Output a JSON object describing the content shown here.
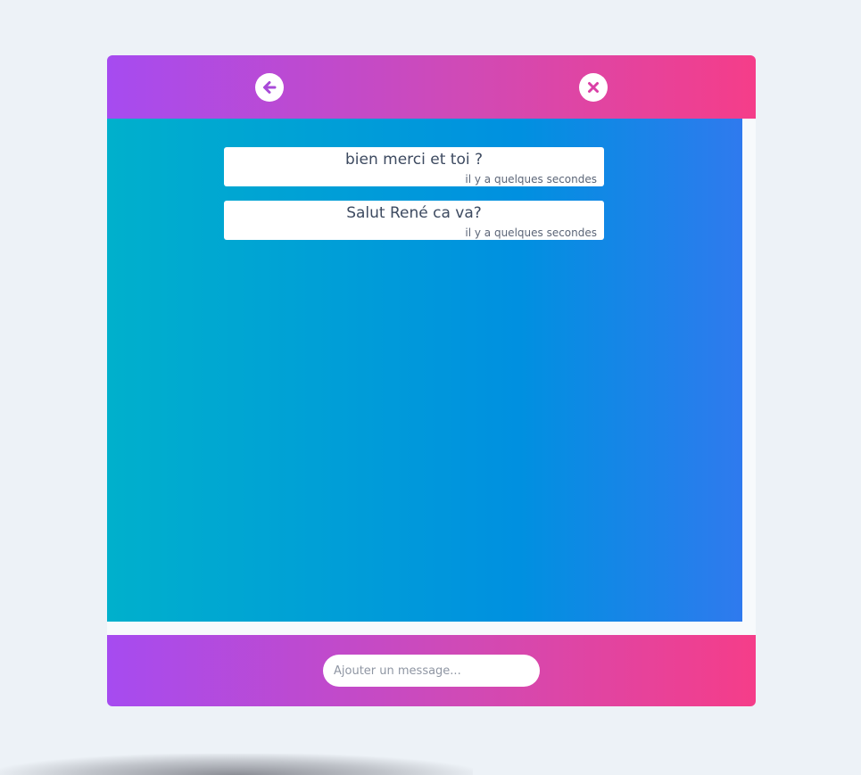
{
  "header": {
    "back_icon": "arrow-left-circle-icon",
    "close_icon": "close-circle-icon"
  },
  "messages": [
    {
      "text": "bien merci et toi ?",
      "time": "il y a quelques secondes"
    },
    {
      "text": "Salut René ca va?",
      "time": "il y a quelques secondes"
    }
  ],
  "footer": {
    "input_value": "",
    "input_placeholder": "Ajouter un message..."
  },
  "colors": {
    "header_gradient_start": "#a64bf0",
    "header_gradient_end": "#f53d89",
    "body_gradient_start": "#00b0cc",
    "body_gradient_mid": "#0090e0",
    "body_gradient_end": "#2f7aee",
    "page_background": "#edf2f7",
    "text": "#3d4a60"
  }
}
